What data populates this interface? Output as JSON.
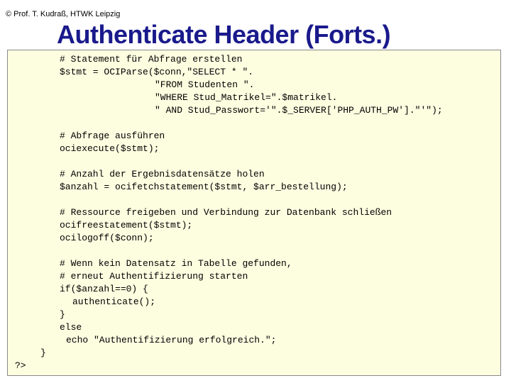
{
  "header": {
    "copyright": "© Prof. T. Kudraß, HTWK Leipzig",
    "title": "Authenticate Header (Forts.)"
  },
  "code": {
    "lines": [
      "# Statement für Abfrage erstellen",
      "$stmt = OCIParse($conn,\"SELECT * \".",
      "\"FROM Studenten \".",
      "\"WHERE Stud_Matrikel=\".$matrikel.",
      "\" AND Stud_Passwort='\".$_SERVER['PHP_AUTH_PW'].\"'\");",
      "# Abfrage ausführen",
      "ociexecute($stmt);",
      "# Anzahl der Ergebnisdatensätze holen",
      "$anzahl = ocifetchstatement($stmt, $arr_bestellung);",
      "# Ressource freigeben und Verbindung zur Datenbank schließen",
      "ocifreestatement($stmt);",
      "ocilogoff($conn);",
      "# Wenn kein Datensatz in Tabelle gefunden,",
      "# erneut Authentifizierung starten",
      "if($anzahl==0) {",
      "authenticate();",
      "}",
      "else",
      "echo \"Authentifizierung erfolgreich.\";",
      "}",
      "?>"
    ]
  }
}
